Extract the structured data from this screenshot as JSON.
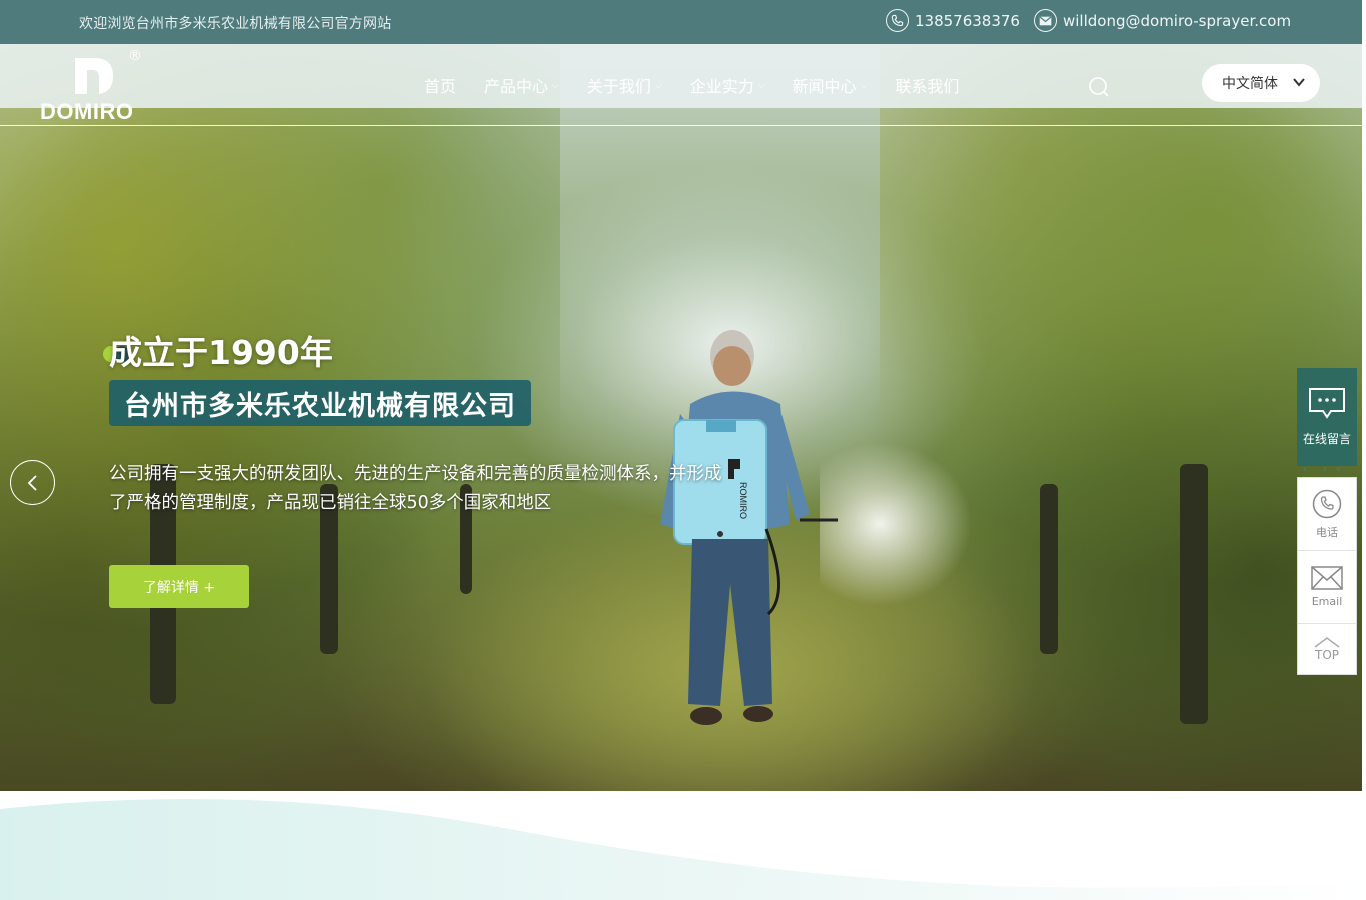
{
  "topbar": {
    "welcome": "欢迎浏览台州市多米乐农业机械有限公司官方网站",
    "phone": "13857638376",
    "email": "willdong@domiro-sprayer.com"
  },
  "logo": {
    "wordmark": "DOMIRO",
    "registered": "®"
  },
  "nav": {
    "items": [
      {
        "label": "首页",
        "has_dropdown": false
      },
      {
        "label": "产品中心",
        "has_dropdown": true
      },
      {
        "label": "关于我们",
        "has_dropdown": true
      },
      {
        "label": "企业实力",
        "has_dropdown": true
      },
      {
        "label": "新闻中心",
        "has_dropdown": true
      },
      {
        "label": "联系我们",
        "has_dropdown": false
      }
    ],
    "language": "中文简体"
  },
  "hero": {
    "since": "成立于1990年",
    "company": "台州市多米乐农业机械有限公司",
    "description": "公司拥有一支强大的研发团队、先进的生产设备和完善的质量检测体系，并形成了严格的管理制度，产品现已销往全球50多个国家和地区",
    "button": "了解详情 +"
  },
  "side": {
    "message": "在线留言",
    "phone": "电话",
    "email": "Email",
    "top": "TOP"
  },
  "colors": {
    "topbar": "#4f7b7d",
    "accent_green": "#a8d23a",
    "company_box": "#1e5f69",
    "message_box": "#2e6a60"
  }
}
